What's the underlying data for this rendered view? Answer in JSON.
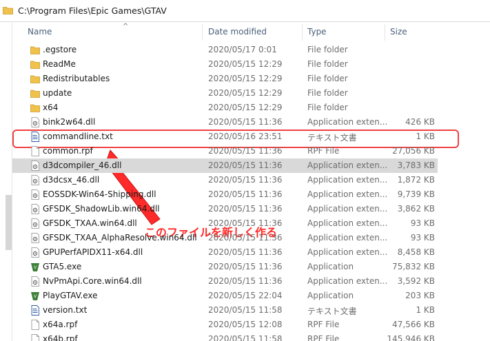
{
  "address": {
    "path": "C:\\Program Files\\Epic Games\\GTAV"
  },
  "columns": {
    "name": "Name",
    "date": "Date modified",
    "type": "Type",
    "size": "Size"
  },
  "annotation": {
    "text": "このファイルを新しく作る"
  },
  "colors": {
    "annotation": "#ff2a2a",
    "selected_row": "#d9d9d9",
    "folder": "#f0c24c"
  },
  "files": [
    {
      "icon": "folder-icon",
      "name": ".egstore",
      "date": "2020/05/17 0:01",
      "type": "File folder",
      "size": ""
    },
    {
      "icon": "folder-icon",
      "name": "ReadMe",
      "date": "2020/05/15 12:29",
      "type": "File folder",
      "size": ""
    },
    {
      "icon": "folder-icon",
      "name": "Redistributables",
      "date": "2020/05/15 12:29",
      "type": "File folder",
      "size": ""
    },
    {
      "icon": "folder-icon",
      "name": "update",
      "date": "2020/05/15 12:29",
      "type": "File folder",
      "size": ""
    },
    {
      "icon": "folder-icon",
      "name": "x64",
      "date": "2020/05/15 12:29",
      "type": "File folder",
      "size": ""
    },
    {
      "icon": "dll-icon",
      "name": "bink2w64.dll",
      "date": "2020/05/15 11:36",
      "type": "Application exten...",
      "size": "426 KB"
    },
    {
      "icon": "text-file-icon",
      "name": "commandline.txt",
      "date": "2020/05/16 23:51",
      "type": "テキスト文書",
      "size": "1 KB"
    },
    {
      "icon": "file-icon",
      "name": "common.rpf",
      "date": "2020/05/15 11:36",
      "type": "RPF File",
      "size": "27,056 KB"
    },
    {
      "icon": "dll-icon",
      "name": "d3dcompiler_46.dll",
      "date": "2020/05/15 11:36",
      "type": "Application exten...",
      "size": "3,783 KB"
    },
    {
      "icon": "dll-icon",
      "name": "d3dcsx_46.dll",
      "date": "2020/05/15 11:36",
      "type": "Application exten...",
      "size": "1,872 KB"
    },
    {
      "icon": "dll-icon",
      "name": "EOSSDK-Win64-Shipping.dll",
      "date": "2020/05/15 11:36",
      "type": "Application exten...",
      "size": "9,739 KB"
    },
    {
      "icon": "dll-icon",
      "name": "GFSDK_ShadowLib.win64.dll",
      "date": "2020/05/15 11:36",
      "type": "Application exten...",
      "size": "3,862 KB"
    },
    {
      "icon": "dll-icon",
      "name": "GFSDK_TXAA.win64.dll",
      "date": "2020/05/15 11:36",
      "type": "Application exten...",
      "size": "93 KB"
    },
    {
      "icon": "dll-icon",
      "name": "GFSDK_TXAA_AlphaResolve.win64.dll",
      "date": "2020/05/15 11:36",
      "type": "Application exten...",
      "size": "93 KB"
    },
    {
      "icon": "dll-icon",
      "name": "GPUPerfAPIDX11-x64.dll",
      "date": "2020/05/15 11:36",
      "type": "Application exten...",
      "size": "8,458 KB"
    },
    {
      "icon": "gta-app-icon",
      "name": "GTA5.exe",
      "date": "2020/05/15 11:36",
      "type": "Application",
      "size": "75,832 KB"
    },
    {
      "icon": "dll-icon",
      "name": "NvPmApi.Core.win64.dll",
      "date": "2020/05/15 11:36",
      "type": "Application exten...",
      "size": "3,592 KB"
    },
    {
      "icon": "gta-app-icon",
      "name": "PlayGTAV.exe",
      "date": "2020/05/15 22:04",
      "type": "Application",
      "size": "203 KB"
    },
    {
      "icon": "text-file-icon",
      "name": "version.txt",
      "date": "2020/05/15 11:58",
      "type": "テキスト文書",
      "size": "1 KB"
    },
    {
      "icon": "file-icon",
      "name": "x64a.rpf",
      "date": "2020/05/15 12:08",
      "type": "RPF File",
      "size": "47,566 KB"
    },
    {
      "icon": "file-icon",
      "name": "x64b.rpf",
      "date": "2020/05/15 11:58",
      "type": "RPF File",
      "size": "145,946 KB"
    }
  ]
}
